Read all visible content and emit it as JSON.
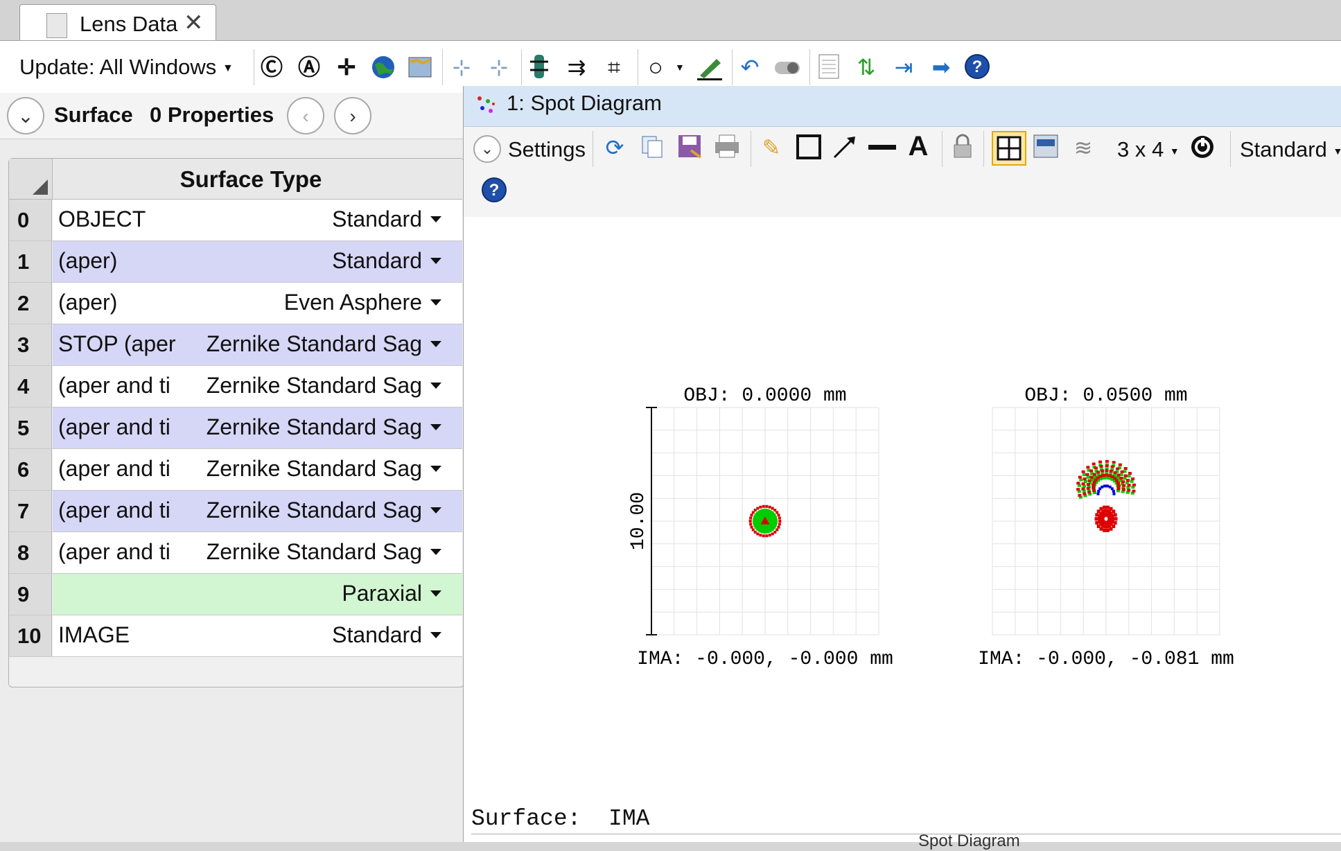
{
  "tab": {
    "title": "Lens Data"
  },
  "toolbar": {
    "update_label": "Update: All Windows"
  },
  "surface_bar": {
    "surface_label": "Surface",
    "properties_label": "0 Properties"
  },
  "grid": {
    "column_header": "Surface Type",
    "rows": [
      {
        "num": "0",
        "comment": "OBJECT",
        "type": "Standard",
        "color": "white"
      },
      {
        "num": "1",
        "comment": "(aper)",
        "type": "Standard",
        "color": "purple"
      },
      {
        "num": "2",
        "comment": "(aper)",
        "type": "Even Asphere",
        "color": "white"
      },
      {
        "num": "3",
        "comment": "STOP (aper",
        "type": "Zernike Standard Sag",
        "color": "purple"
      },
      {
        "num": "4",
        "comment": "(aper and ti",
        "type": "Zernike Standard Sag",
        "color": "white"
      },
      {
        "num": "5",
        "comment": "(aper and ti",
        "type": "Zernike Standard Sag",
        "color": "purple"
      },
      {
        "num": "6",
        "comment": "(aper and ti",
        "type": "Zernike Standard Sag",
        "color": "white"
      },
      {
        "num": "7",
        "comment": "(aper and ti",
        "type": "Zernike Standard Sag",
        "color": "purple"
      },
      {
        "num": "8",
        "comment": "(aper and ti",
        "type": "Zernike Standard Sag",
        "color": "white"
      },
      {
        "num": "9",
        "comment": "",
        "type": "Paraxial",
        "color": "green"
      },
      {
        "num": "10",
        "comment": "IMAGE",
        "type": "Standard",
        "color": "white"
      }
    ]
  },
  "spot_window": {
    "title": "1: Spot Diagram",
    "settings_label": "Settings",
    "layout_label": "3 x 4",
    "display_mode": "Standard",
    "surface_label": "Surface:  IMA",
    "bottom_cut_text": "Spot Diagram"
  },
  "chart_data": [
    {
      "type": "scatter",
      "title": "OBJ:  0.0000  mm",
      "xlabel": "IMA:  -0.000,  -0.000  mm",
      "ylabel": "10.00",
      "series": [
        {
          "color": "#00cc00",
          "shape": "dense disc",
          "center": [
            0.0,
            0.0
          ],
          "radius": 0.55
        },
        {
          "color": "#dd0000",
          "shape": "ring",
          "center": [
            0.0,
            0.0
          ],
          "radius": 0.65
        },
        {
          "color": "#dd0000",
          "shape": "core",
          "center": [
            0.0,
            0.0
          ],
          "radius": 0.2
        }
      ]
    },
    {
      "type": "scatter",
      "title": "OBJ:  0.0500  mm",
      "xlabel": "IMA:  -0.000,  -0.081  mm",
      "series": [
        {
          "color": "#00cc00",
          "shape": "arcs",
          "center": [
            0.0,
            1.4
          ],
          "radius": 1.2
        },
        {
          "color": "#dd0000",
          "shape": "arcs",
          "center": [
            0.0,
            1.5
          ],
          "radius": 1.25
        },
        {
          "color": "#0000dd",
          "shape": "arc",
          "center": [
            0.0,
            1.2
          ],
          "radius": 0.35
        },
        {
          "color": "#dd0000",
          "shape": "cluster",
          "center": [
            0.0,
            0.1
          ],
          "radius": 0.45
        }
      ]
    }
  ]
}
